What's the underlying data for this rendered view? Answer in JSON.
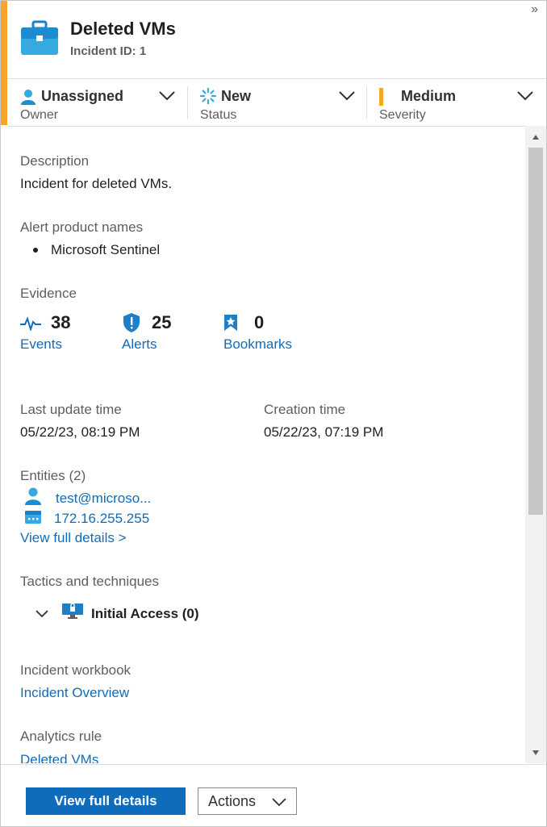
{
  "header": {
    "title": "Deleted VMs",
    "subtitle": "Incident ID: 1",
    "collapse_icon": "»"
  },
  "meta": {
    "owner": {
      "value": "Unassigned",
      "label": "Owner"
    },
    "status": {
      "value": "New",
      "label": "Status"
    },
    "severity": {
      "value": "Medium",
      "label": "Severity",
      "color": "#f5a623"
    }
  },
  "description": {
    "label": "Description",
    "text": "Incident for deleted VMs."
  },
  "alert_products": {
    "label": "Alert product names",
    "items": [
      "Microsoft Sentinel"
    ]
  },
  "evidence": {
    "label": "Evidence",
    "events": {
      "count": "38",
      "label": "Events"
    },
    "alerts": {
      "count": "25",
      "label": "Alerts"
    },
    "bookmarks": {
      "count": "0",
      "label": "Bookmarks"
    }
  },
  "times": {
    "last_update": {
      "label": "Last update time",
      "value": "05/22/23, 08:19 PM"
    },
    "creation": {
      "label": "Creation time",
      "value": "05/22/23, 07:19 PM"
    }
  },
  "entities": {
    "label": "Entities (2)",
    "items": [
      "test@microso...",
      "172.16.255.255"
    ],
    "view_link": "View full details >"
  },
  "tactics": {
    "label": "Tactics and techniques",
    "items": [
      "Initial Access (0)"
    ]
  },
  "workbook": {
    "label": "Incident workbook",
    "link": "Incident Overview"
  },
  "analytics": {
    "label": "Analytics rule",
    "link": "Deleted VMs"
  },
  "footer": {
    "primary": "View full details",
    "secondary": "Actions"
  },
  "colors": {
    "accent": "#f5a623",
    "link": "#0f6cbd",
    "primary_button": "#0f6cbd"
  }
}
